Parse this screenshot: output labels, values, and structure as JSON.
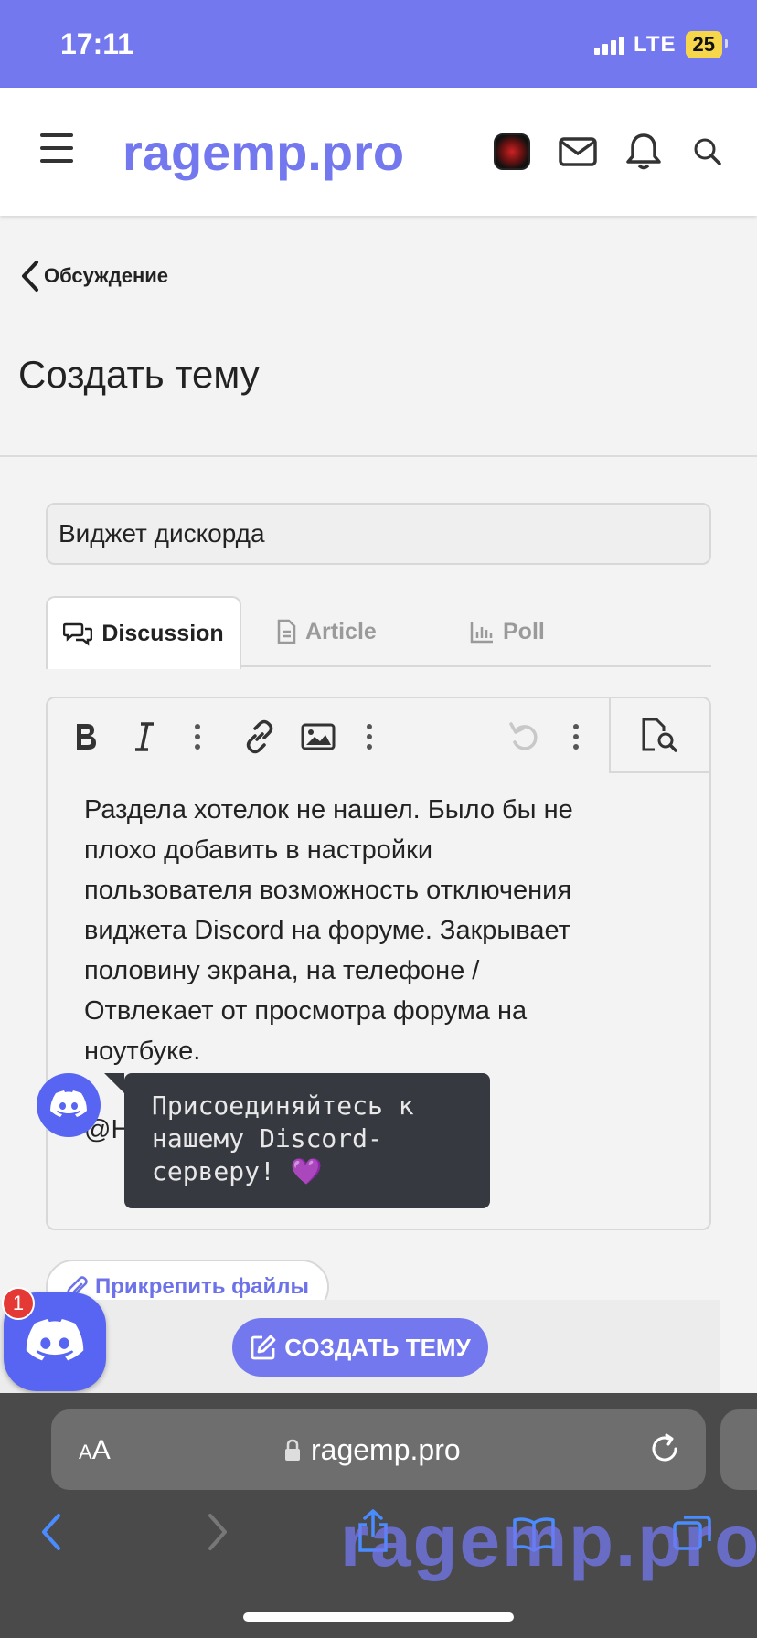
{
  "status_bar": {
    "time": "17:11",
    "network": "LTE",
    "battery": "25"
  },
  "header": {
    "logo": "ragemp.pro"
  },
  "breadcrumb": {
    "label": "Обсуждение"
  },
  "page": {
    "title": "Создать тему"
  },
  "form": {
    "title_value": "Виджет дискорда",
    "tabs": [
      {
        "label": "Discussion",
        "icon": "chat-icon",
        "active": true
      },
      {
        "label": "Article",
        "icon": "document-icon",
        "active": false
      },
      {
        "label": "Poll",
        "icon": "bar-chart-icon",
        "active": false
      }
    ],
    "body_lines": [
      "Раздела хотелок не нашел. Было бы не",
      "плохо добавить в настройки",
      "пользователя возможность отключения",
      "виджета Discord на форуме. Закрывает",
      "половину экрана, на телефоне /",
      "Отвлекает от просмотра форума на",
      "ноутбуке."
    ],
    "mention_partial": "@H",
    "attach_label": "Прикрепить файлы",
    "submit_label": "СОЗДАТЬ ТЕМУ"
  },
  "discord_widget": {
    "tooltip": "Присоединяйтесь к нашему Discord-серверу! 💜",
    "tooltip_lines": [
      "Присоединяйтесь к",
      "нашему Discord-",
      "серверу! 💜"
    ],
    "badge_count": "1"
  },
  "browser": {
    "text_size_label_small": "A",
    "text_size_label": "A",
    "url": "ragemp.pro",
    "watermark": "ragemp.pro"
  },
  "colors": {
    "accent": "#7378ef",
    "discord": "#5865f2",
    "status_bar": "#7478ef"
  }
}
